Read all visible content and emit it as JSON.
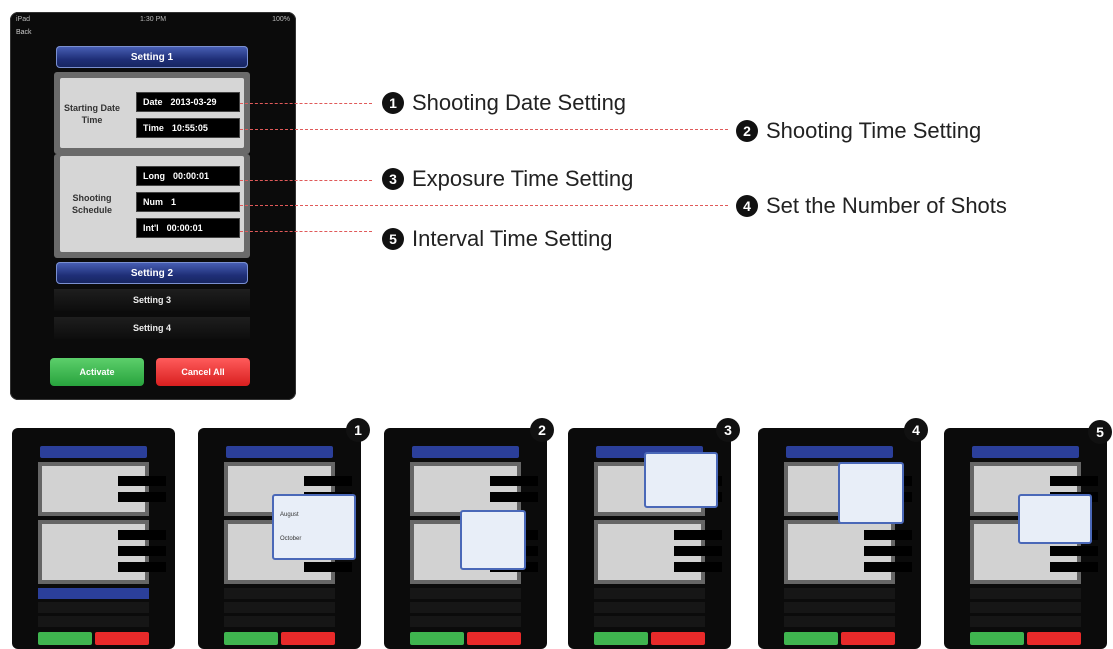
{
  "device": {
    "status": {
      "left": "iPad",
      "center": "1:30 PM",
      "right": "100%"
    },
    "back_label": "Back",
    "settings": [
      {
        "label": "Setting 1"
      },
      {
        "label": "Setting 2"
      },
      {
        "label": "Setting 3"
      },
      {
        "label": "Setting 4"
      }
    ],
    "starting": {
      "group_label": "Starting Date Time",
      "date_key": "Date",
      "date_value": "2013-03-29",
      "time_key": "Time",
      "time_value": "10:55:05"
    },
    "schedule": {
      "group_label": "Shooting Schedule",
      "long_key": "Long",
      "long_value": "00:00:01",
      "num_key": "Num",
      "num_value": "1",
      "int_key": "Int'l",
      "int_value": "00:00:01"
    },
    "activate_label": "Activate",
    "cancel_label": "Cancel All"
  },
  "callouts": [
    {
      "num": "1",
      "text": "Shooting Date Setting"
    },
    {
      "num": "2",
      "text": "Shooting Time Setting"
    },
    {
      "num": "3",
      "text": "Exposure Time Setting"
    },
    {
      "num": "4",
      "text": "Set the Number of Shots"
    },
    {
      "num": "5",
      "text": "Interval Time Setting"
    }
  ],
  "thumb_numbers": [
    "1",
    "2",
    "3",
    "4",
    "5"
  ],
  "popup_months": [
    "August",
    "October"
  ],
  "colors": {
    "accent": "#2b3f9a",
    "activate": "#3fb54f",
    "cancel": "#e82a2a",
    "dash": "#e05a5a"
  }
}
